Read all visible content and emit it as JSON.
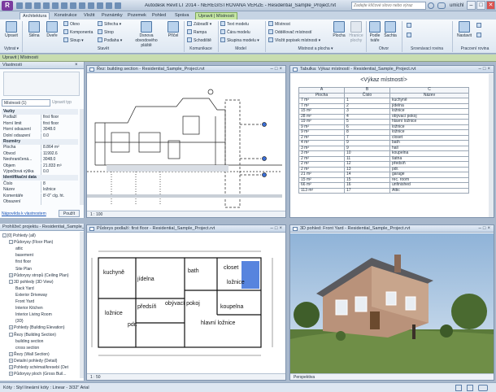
{
  "titlebar": {
    "logo": "R",
    "title": "Autodesk Revit LT 2014 - NEREGISTROVANÁ VERZE -    Residential_Sample_Project.rvt",
    "search_placeholder": "Zadejte klíčové slovo nebo výraz",
    "user": "umichl",
    "min": "–",
    "max": "□",
    "close": "✕"
  },
  "tabs": [
    "Architektura",
    "Konstrukce",
    "Vložit",
    "Poznámky",
    "Pozemek",
    "Pohled",
    "Správa",
    "Upravit | Místnosti"
  ],
  "ribbon": {
    "select_label": "Upravit",
    "select_group": "Vybrat ▾",
    "build": {
      "items": [
        "Stěna",
        "Dveře",
        "Okno",
        "Komponenta",
        "Sloup ▾",
        "Střecha ▾",
        "Strop",
        "Podlaha ▾",
        "Dsnova obvodového pláště",
        "Příčel"
      ],
      "title": "Stavět"
    },
    "circulation": {
      "items": [
        "Zábradlí ▾",
        "Rampa",
        "Schodiště"
      ],
      "title": "Komunikace"
    },
    "model": {
      "items": [
        "Text modelu",
        "Čára modelu",
        "Skupina modelu ▾"
      ],
      "title": "Model"
    },
    "room": {
      "items": [
        "Místnost",
        "Oddělovač místností",
        "Vložit popisek místnosti ▾"
      ],
      "title": "Místnost a plocha ▾"
    },
    "area": {
      "items": [
        "Plocha",
        "Hranice plochy",
        "Podle tváře",
        "Šachta"
      ]
    },
    "opening": {
      "title": "Otvor"
    },
    "datum": {
      "title": "Srovnávací rovina"
    },
    "work": {
      "items": [
        "Nastavit"
      ],
      "title": "Pracovní rovina"
    }
  },
  "context_bar": {
    "title": "Upravit | Místnosti"
  },
  "properties": {
    "header": "Vlastnosti",
    "selector": "Místnosti (1)",
    "edit_type": "Upravit typ",
    "rows": [
      {
        "k": "Vazby",
        "v": "",
        "section": true
      },
      {
        "k": "Podlaží",
        "v": "first floor"
      },
      {
        "k": "Horní limit",
        "v": "first floor"
      },
      {
        "k": "Horní odsazení",
        "v": "3048.0"
      },
      {
        "k": "Dolní odsazení",
        "v": "0.0"
      },
      {
        "k": "Rozměry",
        "v": "",
        "section": true
      },
      {
        "k": "Plocha",
        "v": "8.864 m²"
      },
      {
        "k": "Obvod",
        "v": "11992.6"
      },
      {
        "k": "Neohraničená...",
        "v": "3048.0"
      },
      {
        "k": "Objem",
        "v": "21.833 m³"
      },
      {
        "k": "Výpočtová výška",
        "v": "0.0"
      },
      {
        "k": "Identifikační data",
        "v": "",
        "section": true
      },
      {
        "k": "Číslo",
        "v": "8"
      },
      {
        "k": "Název",
        "v": "ložnice"
      },
      {
        "k": "Komentáře",
        "v": "8'-0\" clg. ht."
      },
      {
        "k": "Obsazení",
        "v": ""
      }
    ],
    "help_link": "Nápověda k vlastnostem",
    "apply": "Použít"
  },
  "browser": {
    "header": "Prohlížeč projektu - Residential_Sample_Project.rvt",
    "items": [
      {
        "label": "[0] Pohledy (all)",
        "lvl": 0,
        "ex": "-"
      },
      {
        "label": "Půdorysy (Floor Plan)",
        "lvl": 1,
        "ex": "-"
      },
      {
        "label": "attic",
        "lvl": 2,
        "ex": ""
      },
      {
        "label": "basement",
        "lvl": 2,
        "ex": ""
      },
      {
        "label": "first floor",
        "lvl": 2,
        "ex": ""
      },
      {
        "label": "Site Plan",
        "lvl": 2,
        "ex": ""
      },
      {
        "label": "Půdorysy stropů (Ceiling Plan)",
        "lvl": 1,
        "ex": "+"
      },
      {
        "label": "3D pohledy (3D View)",
        "lvl": 1,
        "ex": "-"
      },
      {
        "label": "Back Yard",
        "lvl": 2,
        "ex": ""
      },
      {
        "label": "Exterior Driveway",
        "lvl": 2,
        "ex": ""
      },
      {
        "label": "Front Yard",
        "lvl": 2,
        "ex": ""
      },
      {
        "label": "Interior Kitchen",
        "lvl": 2,
        "ex": ""
      },
      {
        "label": "Interior Living Room",
        "lvl": 2,
        "ex": ""
      },
      {
        "label": "{3D}",
        "lvl": 2,
        "ex": ""
      },
      {
        "label": "Pohledy (Building Elevation)",
        "lvl": 1,
        "ex": "+"
      },
      {
        "label": "Řezy (Building Section)",
        "lvl": 1,
        "ex": "-"
      },
      {
        "label": "building section",
        "lvl": 2,
        "ex": ""
      },
      {
        "label": "cross section",
        "lvl": 2,
        "ex": ""
      },
      {
        "label": "Řezy (Wall Section)",
        "lvl": 1,
        "ex": "+"
      },
      {
        "label": "Detailní pohledy (Detail)",
        "lvl": 1,
        "ex": "+"
      },
      {
        "label": "Pohledy schémat/kresebí (Det",
        "lvl": 1,
        "ex": "+"
      },
      {
        "label": "Půdorysy ploch (Gross Buil...",
        "lvl": 1,
        "ex": "+"
      }
    ]
  },
  "views": {
    "section": {
      "title": "Řez: building section - Residential_Sample_Project.rvt",
      "scale": "1 : 100"
    },
    "schedule": {
      "title": "Tabulka: Výkaz místností - Residential_Sample_Project.rvt"
    },
    "plan": {
      "title": "Půdorys podlaží: first floor - Residential_Sample_Project.rvt",
      "scale": "1 : 50"
    },
    "view3d": {
      "title": "3D pohled: Front Yard - Residential_Sample_Project.rvt",
      "mode": "Perspektiva"
    }
  },
  "plan_labels": [
    "kuchyně",
    "jídelna",
    "bath",
    "closet",
    "ložnice",
    "obývací pokoj",
    "předsíň",
    "koupelna",
    "ložnice",
    "pdr.",
    "hlavní ložnice"
  ],
  "schedule": {
    "title": "<Výkaz místností>",
    "cols": [
      "A",
      "B",
      "C"
    ],
    "headers": [
      "Plocha",
      "Číslo",
      "Název"
    ],
    "rows": [
      [
        "7 m²",
        "1",
        "kuchyně"
      ],
      [
        "7 m²",
        "2",
        "jídelna"
      ],
      [
        "15 m²",
        "3",
        "ložnice"
      ],
      [
        "28 m²",
        "4",
        "obývací pokoj"
      ],
      [
        "19 m²",
        "5",
        "hlavní ložnice"
      ],
      [
        "9 m²",
        "6",
        "ložnice"
      ],
      [
        "9 m²",
        "8",
        "ložnice"
      ],
      [
        "2 m²",
        "7",
        "closet"
      ],
      [
        "4 m²",
        "9",
        "bath"
      ],
      [
        "3 m²",
        "9",
        "hall"
      ],
      [
        "3 m²",
        "10",
        "koupelna"
      ],
      [
        "2 m²",
        "11",
        "šatna"
      ],
      [
        "2 m²",
        "12",
        "předsíň"
      ],
      [
        "2 m²",
        "13",
        "pdr."
      ],
      [
        "21 m²",
        "14",
        "garage"
      ],
      [
        "15 m²",
        "15",
        "rec. room"
      ],
      [
        "66 m²",
        "16",
        "unfinished"
      ],
      [
        "113 m²",
        "17",
        "Attic"
      ]
    ]
  },
  "status": {
    "text": "Kóty : Styl lineární kóty : Linear - 3/32\" Arial"
  },
  "colors": {
    "ribbon_ctx": "#c5e6a2",
    "selected_room": "#3a6fd8",
    "plan_bg": "#ffffff"
  }
}
